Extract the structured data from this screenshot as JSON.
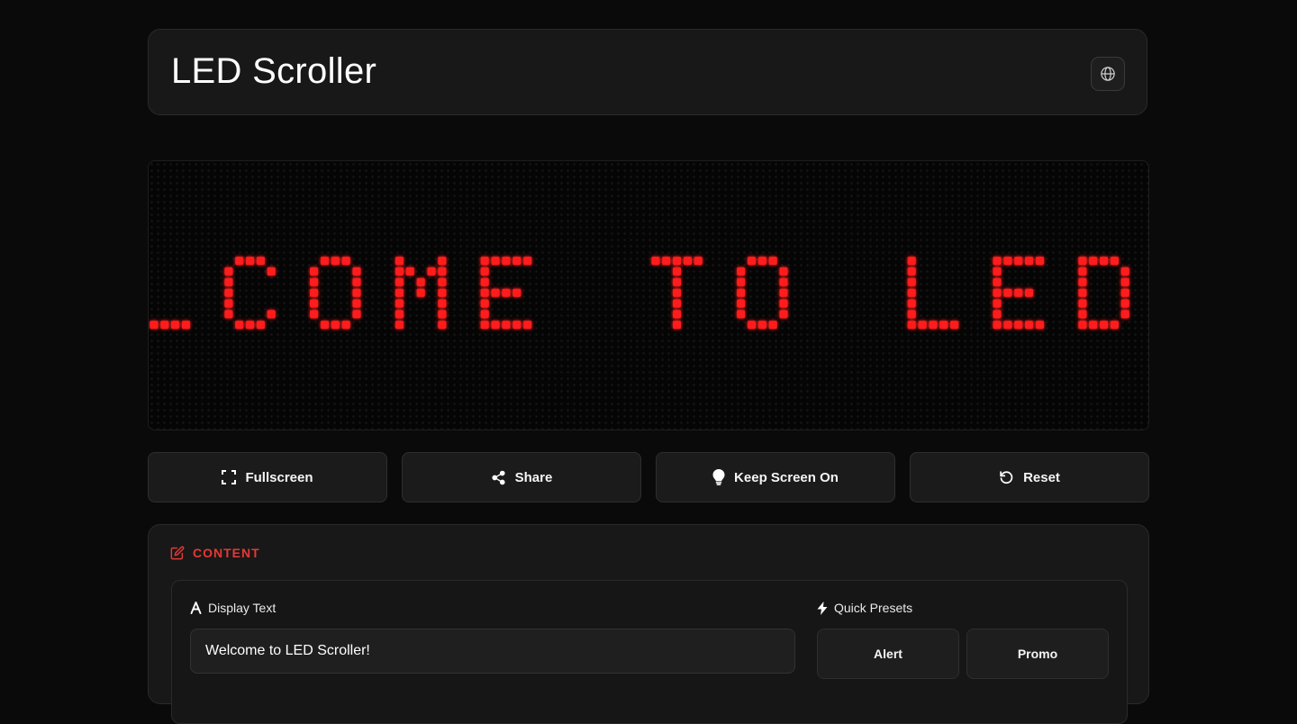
{
  "header": {
    "title": "LED Scroller",
    "language_icon": "globe-icon"
  },
  "led_display": {
    "visible_text": "LCOME TO LED SC",
    "color": "#ff1a1a",
    "off_dot_color": "#151515",
    "background": "#050505"
  },
  "actions": [
    {
      "label": "Fullscreen",
      "icon": "fullscreen-icon"
    },
    {
      "label": "Share",
      "icon": "share-icon"
    },
    {
      "label": "Keep Screen On",
      "icon": "lightbulb-icon"
    },
    {
      "label": "Reset",
      "icon": "reset-icon"
    }
  ],
  "content": {
    "section_title": "CONTENT",
    "section_icon": "edit-icon",
    "display_text_label": "Display Text",
    "display_text_value": "Welcome to LED Scroller!",
    "presets_label": "Quick Presets",
    "presets": [
      "Alert",
      "Promo"
    ]
  },
  "colors": {
    "accent": "#e53935",
    "background": "#0a0a0a",
    "card": "#181818"
  }
}
